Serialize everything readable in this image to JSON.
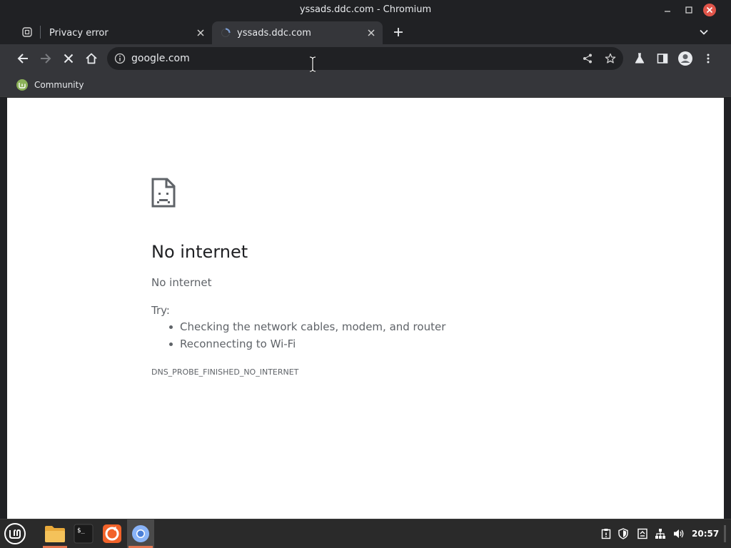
{
  "window": {
    "title": "yssads.ddc.com - Chromium"
  },
  "tabs": [
    {
      "label": "Privacy error",
      "active": false
    },
    {
      "label": "yssads.ddc.com",
      "active": true,
      "loading": true
    }
  ],
  "toolbar": {
    "url": "google.com",
    "forward_enabled": false,
    "loading": true
  },
  "bookmarks": [
    {
      "label": "Community",
      "icon": "linux-mint-icon"
    }
  ],
  "error_page": {
    "heading": "No internet",
    "subtext": "No internet",
    "try_label": "Try:",
    "suggestions": [
      "Checking the network cables, modem, and router",
      "Reconnecting to Wi-Fi"
    ],
    "error_code": "DNS_PROBE_FINISHED_NO_INTERNET"
  },
  "taskbar": {
    "apps": [
      {
        "name": "file-manager",
        "running": true,
        "active": false
      },
      {
        "name": "terminal",
        "running": false,
        "active": false
      },
      {
        "name": "firefox",
        "running": false,
        "active": false
      },
      {
        "name": "chromium",
        "running": true,
        "active": true
      }
    ],
    "clock": "20:57"
  },
  "colors": {
    "close_button": "#e0554a",
    "accent": "#e0734e",
    "mint_green": "#8bb158"
  }
}
